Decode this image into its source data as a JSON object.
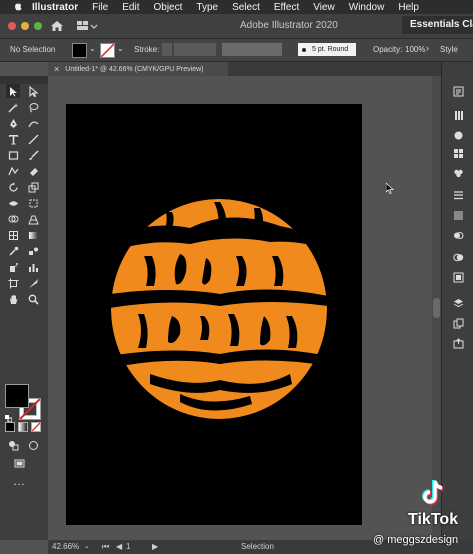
{
  "menubar": {
    "items": [
      "Illustrator",
      "File",
      "Edit",
      "Object",
      "Type",
      "Select",
      "Effect",
      "View",
      "Window",
      "Help"
    ]
  },
  "appbar": {
    "title": "Adobe Illustrator 2020",
    "workspace": "Essentials Clas"
  },
  "control_bar": {
    "selection_label": "No Selection",
    "stroke_label": "Stroke:",
    "brush_value": "5 pt. Round",
    "opacity_label": "Opacity:",
    "opacity_value": "100%",
    "style_label": "Style"
  },
  "document_tab": {
    "title": "Untitled-1* @ 42.66% (CMYK/GPU Preview)",
    "close": "×"
  },
  "statusbar": {
    "zoom": "42.66%",
    "artboard_number": "1",
    "tool_name": "Selection"
  },
  "watermark": {
    "brand": "TikTok",
    "handle": "@ meggszdesign"
  },
  "colors": {
    "artwork": "#f08a1c",
    "artboard": "#000000",
    "ui_dark": "#3e3e3e"
  }
}
